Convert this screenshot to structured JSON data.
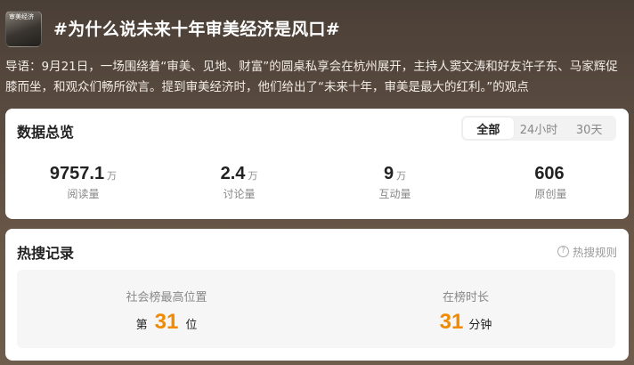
{
  "topic": {
    "thumb_caption": "审美经济",
    "title": "#为什么说未来十年审美经济是风口#",
    "intro": "导语：9月21日，一场围绕着“审美、见地、财富”的圆桌私享会在杭州展开，主持人窦文涛和好友许子东、马家辉促膝而坐，和观众们畅所欲言。提到审美经济时，他们给出了“未来十年，审美是最大的红利。”的观点"
  },
  "overview": {
    "title": "数据总览",
    "tabs": [
      {
        "label": "全部",
        "active": true
      },
      {
        "label": "24小时",
        "active": false
      },
      {
        "label": "30天",
        "active": false
      }
    ],
    "stats": [
      {
        "value": "9757.1",
        "unit": "万",
        "label": "阅读量"
      },
      {
        "value": "2.4",
        "unit": "万",
        "label": "讨论量"
      },
      {
        "value": "9",
        "unit": "万",
        "label": "互动量"
      },
      {
        "value": "606",
        "unit": "",
        "label": "原创量"
      }
    ]
  },
  "hot_search": {
    "title": "热搜记录",
    "rules_label": "热搜规则",
    "rules_icon": "question-circle-icon",
    "highest_position": {
      "label": "社会榜最高位置",
      "prefix": "第",
      "value": "31",
      "suffix": "位"
    },
    "duration": {
      "label": "在榜时长",
      "value": "31",
      "suffix": "分钟"
    },
    "accent_color": "#f08a00"
  }
}
